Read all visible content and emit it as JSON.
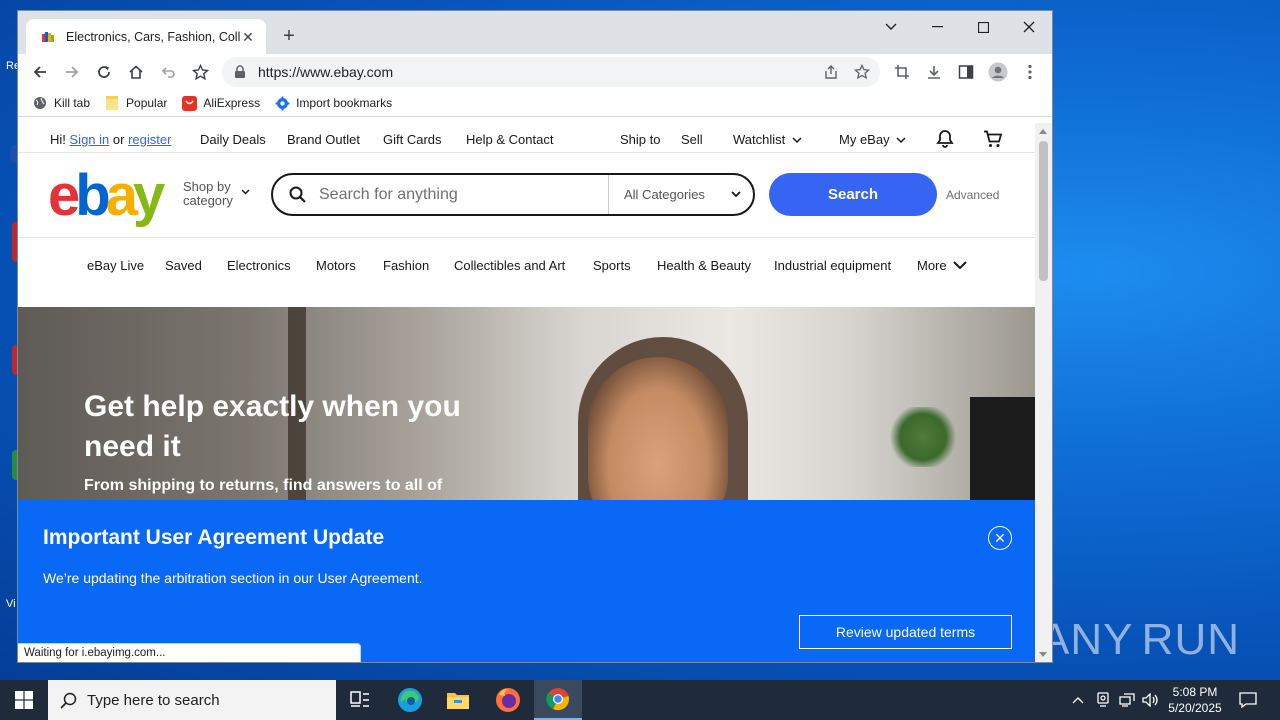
{
  "browser": {
    "tab_title": "Electronics, Cars, Fashion, Collectibles & More | eBay",
    "url": "https://www.ebay.com",
    "bookmarks": [
      {
        "label": "Kill tab",
        "icon": "globe-icon"
      },
      {
        "label": "Popular",
        "icon": "folder-icon"
      },
      {
        "label": "AliExpress",
        "icon": "aliexpress-icon"
      },
      {
        "label": "Import bookmarks",
        "icon": "gear-icon"
      }
    ],
    "status_text": "Waiting for i.ebayimg.com..."
  },
  "ebay": {
    "topbar": {
      "greeting": "Hi!",
      "sign_in": "Sign in",
      "or": "or",
      "register": "register",
      "daily_deals": "Daily Deals",
      "brand_outlet": "Brand Outlet",
      "gift_cards": "Gift Cards",
      "help_contact": "Help & Contact",
      "ship_to": "Ship to",
      "sell": "Sell",
      "watchlist": "Watchlist",
      "my_ebay": "My eBay"
    },
    "header": {
      "shop_by_line1": "Shop by",
      "shop_by_line2": "category",
      "search_placeholder": "Search for anything",
      "category_selected": "All Categories",
      "search_button": "Search",
      "advanced": "Advanced"
    },
    "categories": [
      "eBay Live",
      "Saved",
      "Electronics",
      "Motors",
      "Fashion",
      "Collectibles and Art",
      "Sports",
      "Health & Beauty",
      "Industrial equipment",
      "More"
    ],
    "hero": {
      "title": "Get help exactly when you need it",
      "subtitle": "From shipping to returns, find answers to all of"
    },
    "banner": {
      "title": "Important User Agreement Update",
      "description": "We’re updating the arbitration section in our User Agreement.",
      "button": "Review updated terms"
    }
  },
  "taskbar": {
    "search_placeholder": "Type here to search",
    "time": "5:08 PM",
    "date": "5/20/2025"
  },
  "watermark": {
    "left": "ANY",
    "right": "RUN"
  },
  "colors": {
    "ebay_red": "#e53238",
    "ebay_blue": "#0064d2",
    "ebay_yellow": "#f5af02",
    "ebay_green": "#86b817",
    "search_blue": "#3665f3",
    "banner_blue": "#0968f6"
  }
}
